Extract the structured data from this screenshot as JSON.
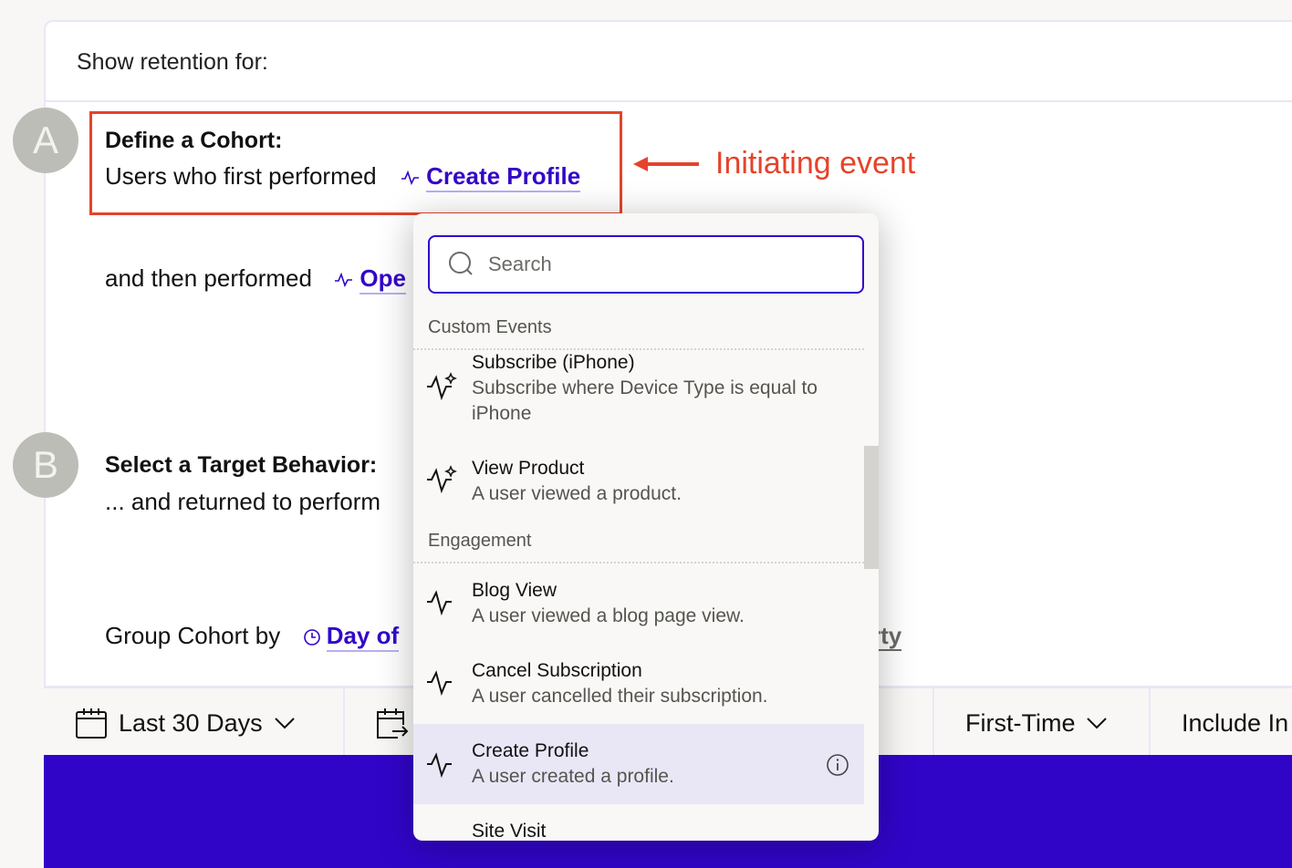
{
  "header": {
    "title": "Show retention for:"
  },
  "cohort": {
    "badge": "A",
    "heading": "Define a Cohort:",
    "prefix": "Users who first performed",
    "event_link": "Create Profile",
    "then_prefix": "and then performed",
    "then_link_partial": "Ope"
  },
  "target": {
    "badge": "B",
    "heading": "Select a Target Behavior:",
    "prefix": "... and returned to perform"
  },
  "group": {
    "prefix": "Group Cohort by",
    "link_partial": "Day of",
    "trailing_partial": "rty"
  },
  "annotation": {
    "label": "Initiating event",
    "color": "#e5432a"
  },
  "toolbar": {
    "date_range": "Last 30 Days",
    "first_time": "First-Time",
    "include_partial": "Include In"
  },
  "dropdown": {
    "search_placeholder": "Search",
    "sections": [
      {
        "label": "Custom Events"
      },
      {
        "label": "Engagement"
      }
    ],
    "items": [
      {
        "title": "Subscribe (iPhone)",
        "desc": "Subscribe where Device Type is equal to iPhone",
        "icon": "custom-event-icon"
      },
      {
        "title": "View Product",
        "desc": "A user viewed a product.",
        "icon": "custom-event-icon"
      },
      {
        "title": "Blog View",
        "desc": "A user viewed a blog page view.",
        "icon": "event-pulse-icon"
      },
      {
        "title": "Cancel Subscription",
        "desc": "A user cancelled their subscription.",
        "icon": "event-pulse-icon"
      },
      {
        "title": "Create Profile",
        "desc": "A user created a profile.",
        "icon": "event-pulse-icon",
        "selected": true
      },
      {
        "title": "Site Visit",
        "desc": "",
        "icon": "event-pulse-icon"
      }
    ]
  },
  "colors": {
    "accent": "#3105c8",
    "highlight": "#e9e7f5",
    "annotation": "#e5432a"
  }
}
